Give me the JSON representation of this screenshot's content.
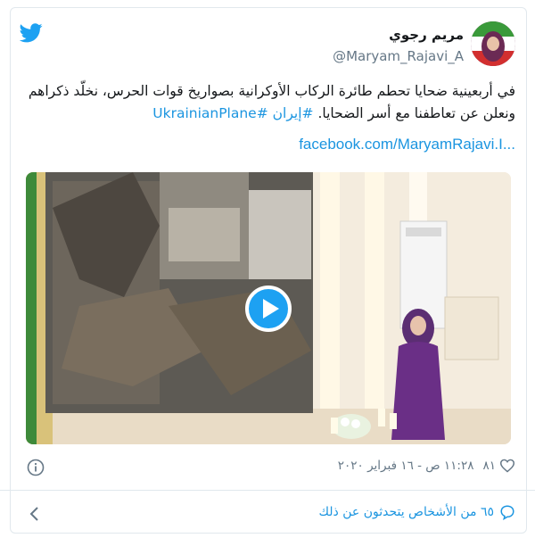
{
  "author": {
    "name": "مریم رجوي",
    "handle": "@Maryam_Rajavi_A"
  },
  "tweet": {
    "text_main": "في أربعينية ضحايا تحطم طائرة الركاب الأوكرانية بصواريخ قوات الحرس، نخلّد ذكراهم ونعلن عن تعاطفنا مع أسر الضحايا.",
    "hashtag_iran": "#إيران",
    "hashtag_plane": "#UkrainianPlane",
    "link_text": "facebook.com/MaryamRajavi.I..."
  },
  "media": {
    "type": "video",
    "play_icon": "play-icon"
  },
  "meta": {
    "time_date": "١١:٢٨ ص - ١٦ فبراير ٢٠٢٠",
    "likes": "٨١",
    "like_icon": "heart-icon",
    "info_icon": "info-icon"
  },
  "footer": {
    "people_talking": "٦٥ من الأشخاص يتحدثون عن ذلك",
    "comment_icon": "comment-icon",
    "chevron_icon": "chevron-left-icon"
  },
  "colors": {
    "accent": "#1b95e0",
    "twitter_blue": "#1da1f2",
    "muted": "#657786",
    "border": "#e1e8ed"
  }
}
